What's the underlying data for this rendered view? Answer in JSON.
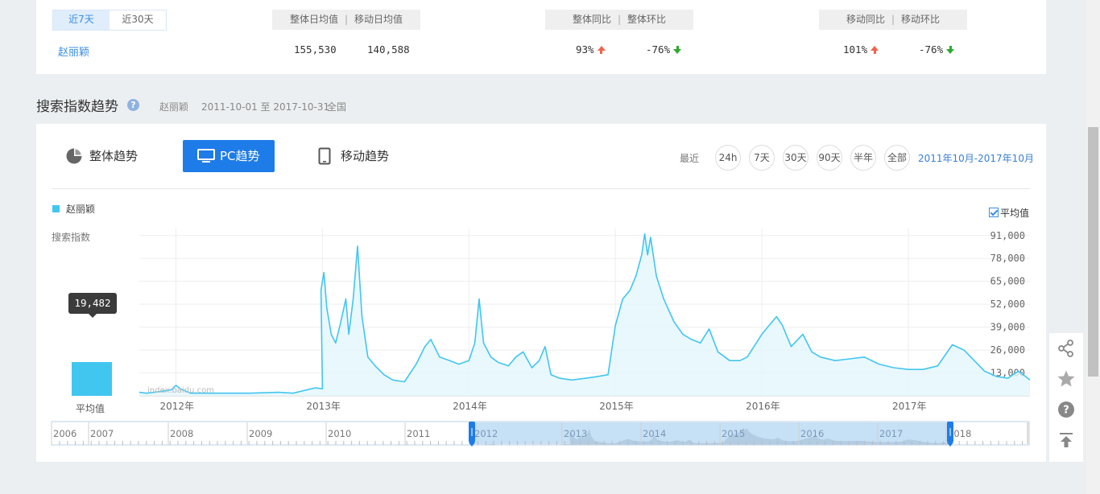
{
  "stats": {
    "period_tabs": [
      "近7天",
      "近30天"
    ],
    "keyword": "赵丽颖",
    "avg_header": {
      "overall": "整体日均值",
      "sep": "|",
      "mobile": "移动日均值"
    },
    "overall_avg": "155,530",
    "mobile_avg": "140,588",
    "ratio_header": {
      "yoy": "整体同比",
      "sep": "|",
      "mom": "整体环比"
    },
    "overall_yoy": "93%",
    "overall_mom": "-76%",
    "mobile_header": {
      "yoy": "移动同比",
      "sep": "|",
      "mom": "移动环比"
    },
    "mobile_yoy": "101%",
    "mobile_mom": "-76%",
    "colors": {
      "up": "#f0644a",
      "down": "#2eaa2e"
    }
  },
  "section": {
    "title": "搜索指数趋势",
    "keyword": "赵丽颖",
    "date_range": "2011-10-01 至 2017-10-31",
    "region": "全国"
  },
  "trend_tabs": [
    {
      "label": "整体趋势",
      "icon": "pie-chart-icon"
    },
    {
      "label": "PC趋势",
      "icon": "monitor-icon",
      "active": true
    },
    {
      "label": "移动趋势",
      "icon": "phone-icon"
    }
  ],
  "range": {
    "label": "最近",
    "buttons": [
      "24h",
      "7天",
      "30天",
      "90天",
      "半年",
      "全部"
    ],
    "selected_range": "2011年10月-2017年10月"
  },
  "legend": {
    "series": "赵丽颖",
    "y_title": "搜索指数",
    "avg_checkbox": "平均值",
    "avg_checked": true
  },
  "tooltip": {
    "value": "19,482"
  },
  "avg_bar_label": "平均值",
  "watermark": "index.baidu.com",
  "chart_data": {
    "type": "area",
    "series_name": "赵丽颖",
    "ytick_labels": [
      "91,000",
      "78,000",
      "65,000",
      "52,000",
      "39,000",
      "26,000",
      "13,000"
    ],
    "yticks": [
      91000,
      78000,
      65000,
      52000,
      39000,
      26000,
      13000
    ],
    "ylim": [
      0,
      95000
    ],
    "xtick_labels": [
      "2012年",
      "2013年",
      "2014年",
      "2015年",
      "2016年",
      "2017年"
    ],
    "xticks": [
      2012.0,
      2013.0,
      2014.0,
      2015.0,
      2016.0,
      2017.0
    ],
    "xlim": [
      2011.75,
      2017.83
    ],
    "average": 19482,
    "points": [
      [
        2011.75,
        2000
      ],
      [
        2011.8,
        1500
      ],
      [
        2011.9,
        2500
      ],
      [
        2011.97,
        3500
      ],
      [
        2012.0,
        6000
      ],
      [
        2012.03,
        4000
      ],
      [
        2012.1,
        1500
      ],
      [
        2012.3,
        1500
      ],
      [
        2012.5,
        1500
      ],
      [
        2012.7,
        2000
      ],
      [
        2012.8,
        1500
      ],
      [
        2012.9,
        3500
      ],
      [
        2012.95,
        4500
      ],
      [
        2013.0,
        4000
      ],
      [
        2012.99,
        60000
      ],
      [
        2013.01,
        70000
      ],
      [
        2013.03,
        50000
      ],
      [
        2013.06,
        35000
      ],
      [
        2013.09,
        30000
      ],
      [
        2013.12,
        40000
      ],
      [
        2013.16,
        55000
      ],
      [
        2013.18,
        35000
      ],
      [
        2013.21,
        55000
      ],
      [
        2013.24,
        85000
      ],
      [
        2013.27,
        45000
      ],
      [
        2013.31,
        22000
      ],
      [
        2013.36,
        17000
      ],
      [
        2013.42,
        12000
      ],
      [
        2013.48,
        9000
      ],
      [
        2013.56,
        8000
      ],
      [
        2013.64,
        18000
      ],
      [
        2013.7,
        28000
      ],
      [
        2013.74,
        32000
      ],
      [
        2013.8,
        22000
      ],
      [
        2013.87,
        20000
      ],
      [
        2013.93,
        18000
      ],
      [
        2014.0,
        20000
      ],
      [
        2014.04,
        30000
      ],
      [
        2014.07,
        55000
      ],
      [
        2014.1,
        30000
      ],
      [
        2014.15,
        22000
      ],
      [
        2014.2,
        19000
      ],
      [
        2014.27,
        17000
      ],
      [
        2014.32,
        22000
      ],
      [
        2014.37,
        25000
      ],
      [
        2014.43,
        16000
      ],
      [
        2014.48,
        20000
      ],
      [
        2014.52,
        28000
      ],
      [
        2014.56,
        12000
      ],
      [
        2014.62,
        10000
      ],
      [
        2014.7,
        9000
      ],
      [
        2014.8,
        10000
      ],
      [
        2014.88,
        11000
      ],
      [
        2014.95,
        12000
      ],
      [
        2015.0,
        40000
      ],
      [
        2015.05,
        55000
      ],
      [
        2015.1,
        60000
      ],
      [
        2015.14,
        68000
      ],
      [
        2015.18,
        80000
      ],
      [
        2015.2,
        92000
      ],
      [
        2015.22,
        80000
      ],
      [
        2015.24,
        90000
      ],
      [
        2015.28,
        68000
      ],
      [
        2015.33,
        55000
      ],
      [
        2015.4,
        42000
      ],
      [
        2015.46,
        35000
      ],
      [
        2015.52,
        32000
      ],
      [
        2015.58,
        30000
      ],
      [
        2015.64,
        38000
      ],
      [
        2015.7,
        25000
      ],
      [
        2015.78,
        20000
      ],
      [
        2015.85,
        20000
      ],
      [
        2015.9,
        22000
      ],
      [
        2016.0,
        35000
      ],
      [
        2016.05,
        40000
      ],
      [
        2016.1,
        45000
      ],
      [
        2016.14,
        40000
      ],
      [
        2016.2,
        28000
      ],
      [
        2016.28,
        35000
      ],
      [
        2016.34,
        25000
      ],
      [
        2016.4,
        22000
      ],
      [
        2016.5,
        20000
      ],
      [
        2016.6,
        21000
      ],
      [
        2016.7,
        22000
      ],
      [
        2016.8,
        18000
      ],
      [
        2016.9,
        16000
      ],
      [
        2017.0,
        15000
      ],
      [
        2017.1,
        15000
      ],
      [
        2017.2,
        17000
      ],
      [
        2017.3,
        29000
      ],
      [
        2017.38,
        26000
      ],
      [
        2017.45,
        20000
      ],
      [
        2017.52,
        14000
      ],
      [
        2017.6,
        11000
      ],
      [
        2017.68,
        10000
      ],
      [
        2017.75,
        14000
      ],
      [
        2017.8,
        11000
      ],
      [
        2017.83,
        9000
      ]
    ]
  },
  "overview": {
    "years": [
      "2006",
      "2007",
      "2008",
      "2009",
      "2010",
      "2011",
      "2012",
      "2013",
      "2014",
      "2015",
      "2016",
      "2017",
      "2018"
    ]
  },
  "float_bar": [
    "share-icon",
    "star-icon",
    "help-circle-icon",
    "back-to-top-icon"
  ]
}
